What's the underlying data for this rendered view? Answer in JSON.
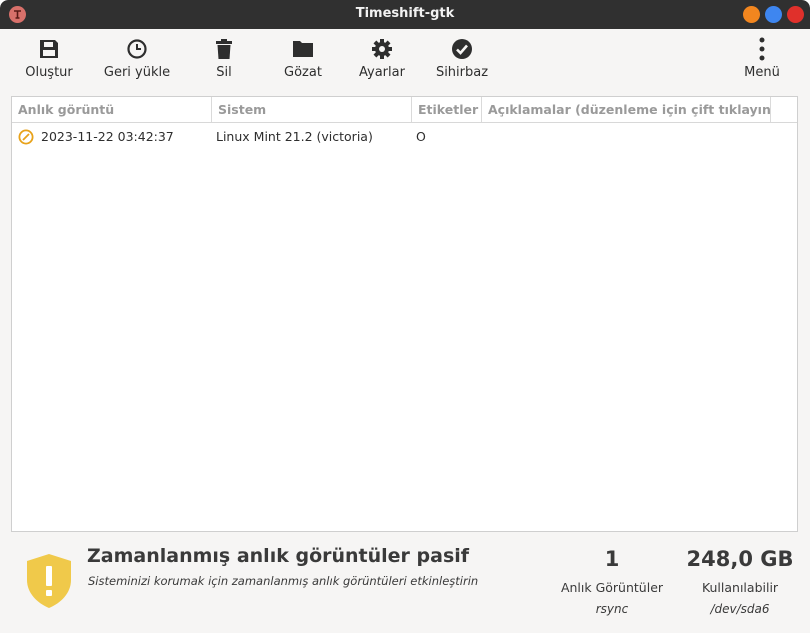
{
  "window": {
    "title": "Timeshift-gtk"
  },
  "toolbar": {
    "create": "Oluştur",
    "restore": "Geri yükle",
    "delete": "Sil",
    "browse": "Gözat",
    "settings": "Ayarlar",
    "wizard": "Sihirbaz",
    "menu": "Menü"
  },
  "table": {
    "columns": [
      "Anlık görüntü",
      "Sistem",
      "Etiketler",
      "Açıklamalar (düzenleme için çift tıklayın)"
    ],
    "rows": [
      {
        "snapshot": "2023-11-22 03:42:37",
        "system": "Linux Mint 21.2 (victoria)",
        "tags": "O",
        "comments": ""
      }
    ]
  },
  "status": {
    "title": "Zamanlanmış anlık görüntüler pasif",
    "message": "Sisteminizi korumak için zamanlanmış anlık görüntüleri etkinleştirin"
  },
  "stats": {
    "snapshots": {
      "value": "1",
      "label": "Anlık Görüntüler",
      "detail": "rsync"
    },
    "available": {
      "value": "248,0 GB",
      "label": "Kullanılabilir",
      "detail": "/dev/sda6"
    }
  },
  "colors": {
    "titlebar": "#303030",
    "window_bg": "#f6f5f4",
    "minimize": "#f2861f",
    "maximize": "#3e86f0",
    "close": "#e0302b",
    "snapshot_icon": "#e8a21a",
    "shield": "#f0c94a"
  }
}
